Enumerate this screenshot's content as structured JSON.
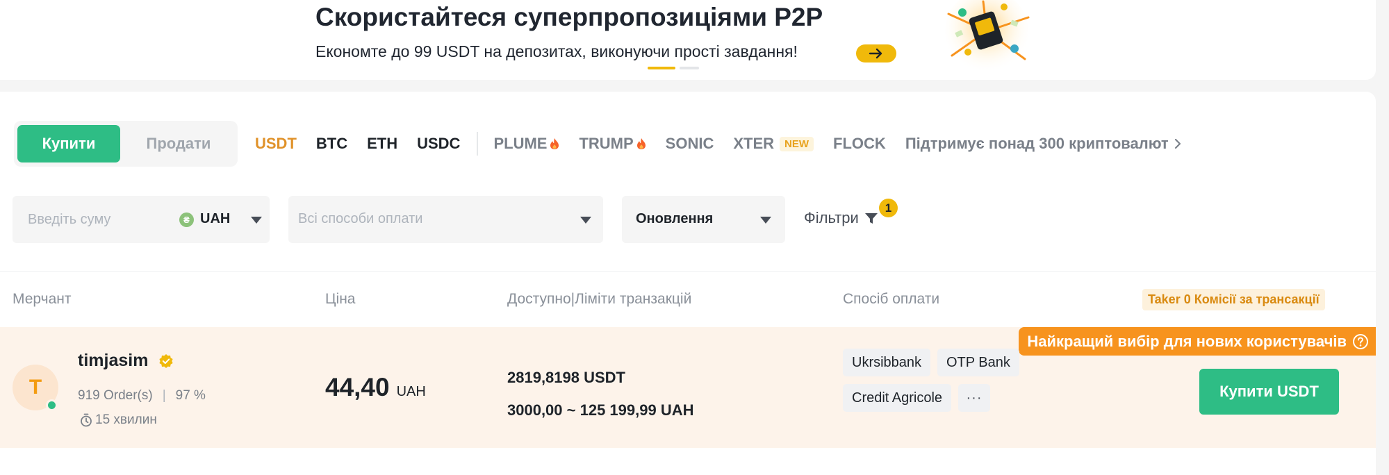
{
  "banner": {
    "title": "Скористайтеся суперпропозиціями P2P",
    "subtitle": "Економте до 99 USDT на депозитах, виконуючи прості завдання!",
    "arrow_icon": "arrow-right-icon",
    "carousel": {
      "count": 2,
      "active": 1
    }
  },
  "trade_toggle": {
    "buy_label": "Купити",
    "sell_label": "Продати",
    "selected": "buy"
  },
  "coins": {
    "items": [
      {
        "label": "USDT",
        "state": "active"
      },
      {
        "label": "BTC",
        "state": "normal"
      },
      {
        "label": "ETH",
        "state": "normal"
      },
      {
        "label": "USDC",
        "state": "normal"
      },
      {
        "label": "PLUME",
        "state": "dim",
        "icon": "fire-icon"
      },
      {
        "label": "TRUMP",
        "state": "dim",
        "icon": "fire-icon"
      },
      {
        "label": "SONIC",
        "state": "dim"
      },
      {
        "label": "XTER",
        "state": "dim",
        "badge": "NEW"
      },
      {
        "label": "FLOCK",
        "state": "dim"
      }
    ],
    "support_link": "Підтримує понад 300 криптовалют"
  },
  "filters": {
    "amount_placeholder": "Введіть суму",
    "fiat_symbol": "₴",
    "fiat": "UAH",
    "payment_placeholder": "Всі способи оплати",
    "sort_label": "Оновлення",
    "filters_label": "Фільтри",
    "filters_count": "1"
  },
  "table": {
    "headers": {
      "merchant": "Мерчант",
      "price": "Ціна",
      "available": "Доступно|Ліміти транзакцій",
      "payment": "Спосіб оплати"
    },
    "taker_badge": "Taker 0 Комісії за трансакції"
  },
  "offer": {
    "best_badge": "Найкращий вибір для нових користувачів",
    "avatar_letter": "T",
    "merchant": "timjasim",
    "orders": "919 Order(s)",
    "completion": "97 %",
    "time": "15 хвилин",
    "price": "44,40",
    "price_currency": "UAH",
    "available": "2819,8198 USDT",
    "limits": "3000,00 ~ 125 199,99 UAH",
    "payment_methods": [
      "Ukrsibbank",
      "OTP Bank",
      "Credit Agricole"
    ],
    "more_label": "···",
    "buy_button": "Купити USDT"
  },
  "colors": {
    "buy_green": "#2ebd85",
    "brand_yellow": "#f0b90b",
    "active_coin": "#e0922a",
    "best_badge": "#f7931e",
    "row_highlight": "#fdf3ea"
  }
}
